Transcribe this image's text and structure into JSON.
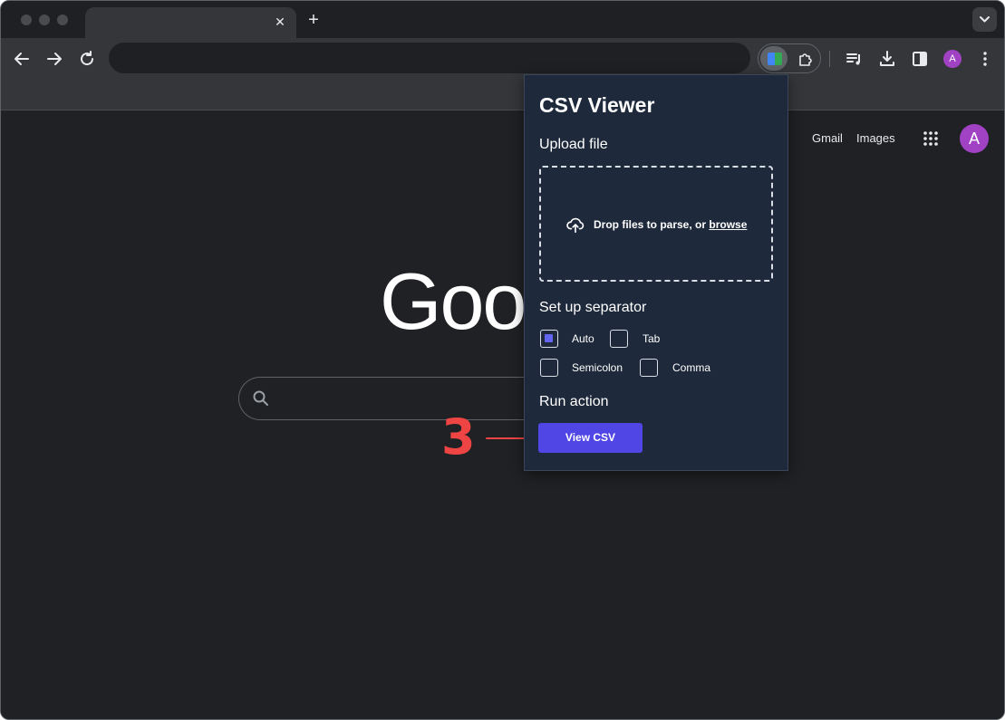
{
  "browser": {
    "new_tab_symbol": "+",
    "tab_close_symbol": "✕",
    "avatar_initial": "A"
  },
  "page": {
    "links": {
      "gmail": "Gmail",
      "images": "Images"
    },
    "avatar_initial": "A",
    "logo_text": "Goo"
  },
  "annotation": {
    "step_number": "3",
    "color": "#ef4444"
  },
  "popup": {
    "title": "CSV Viewer",
    "upload": {
      "heading": "Upload file",
      "drop_text": "Drop files to parse, or ",
      "browse_link": "browse"
    },
    "separator": {
      "heading": "Set up separator",
      "options": [
        {
          "label": "Auto",
          "checked": true
        },
        {
          "label": "Tab",
          "checked": false
        },
        {
          "label": "Semicolon",
          "checked": false
        },
        {
          "label": "Comma",
          "checked": false
        }
      ]
    },
    "action": {
      "heading": "Run action",
      "button_label": "View CSV"
    },
    "colors": {
      "background": "#1e293b",
      "button": "#4f46e5",
      "checkbox_fill": "#6366f1"
    }
  }
}
